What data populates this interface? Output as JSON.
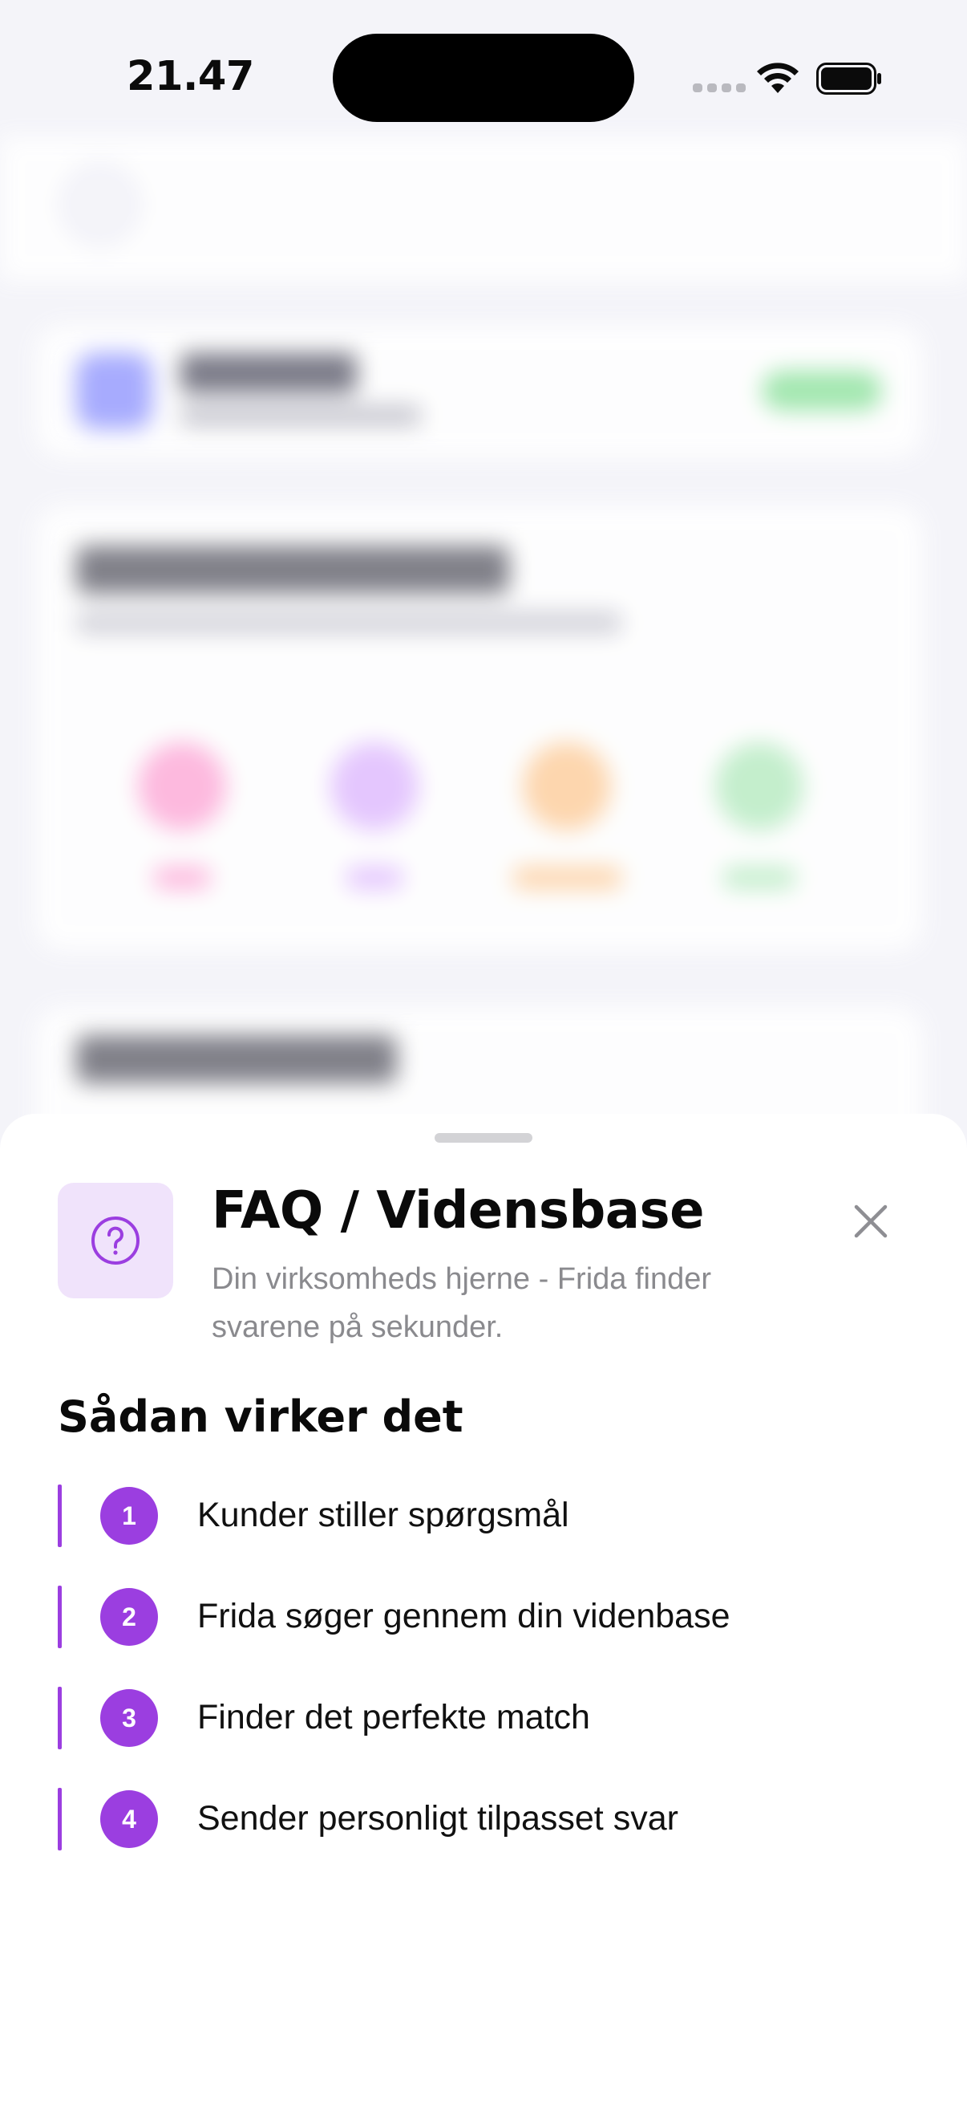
{
  "status_bar": {
    "time": "21.47"
  },
  "sheet": {
    "title": "FAQ / Vidensbase",
    "subtitle": "Din virksomheds hjerne - Frida finder svarene på sekunder.",
    "icon": "question-circle-icon",
    "section_title": "Sådan virker det",
    "steps": [
      {
        "number": "1",
        "text": "Kunder stiller spørgsmål"
      },
      {
        "number": "2",
        "text": "Frida søger gennem din videnbase"
      },
      {
        "number": "3",
        "text": "Finder det perfekte match"
      },
      {
        "number": "4",
        "text": "Sender personligt tilpasset svar"
      }
    ]
  },
  "colors": {
    "accent": "#9b3ee0",
    "icon_tile": "#f0e3fb",
    "subtitle": "#8a8a8e",
    "close_icon": "#8e8e93"
  }
}
